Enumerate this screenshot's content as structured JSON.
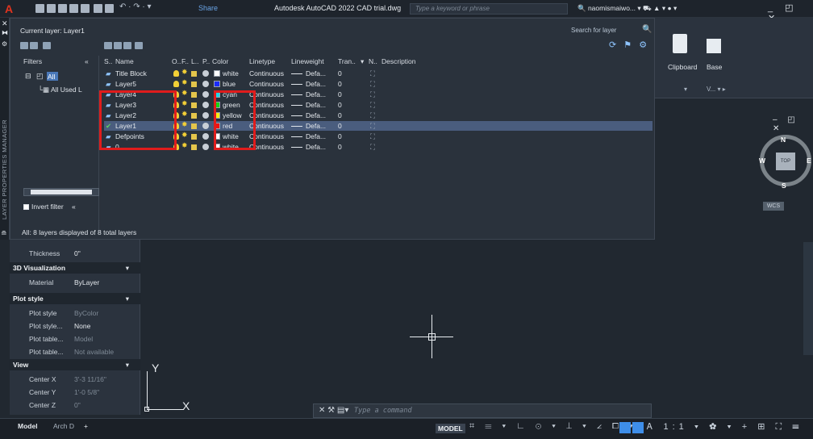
{
  "titlebar": {
    "share": "Share",
    "title": "Autodesk AutoCAD 2022   CAD trial.dwg",
    "search_placeholder": "Type a keyword or phrase",
    "user": "naomismaiwo...",
    "window_controls": "_ ◰ ✕"
  },
  "lpm": {
    "side_label": "LAYER PROPERTIES MANAGER",
    "current_layer": "Current layer: Layer1",
    "search_label": "Search for layer",
    "filters_header": "Filters",
    "filters_collapse": "«",
    "filter_all": "All",
    "filter_all_used": "All Used L",
    "invert_filter": "Invert filter",
    "invert_collapse": "«",
    "status_line": "All: 8 layers displayed of 8 total layers",
    "columns": {
      "s": "S..",
      "name": "Name",
      "o": "O..",
      "f": "F..",
      "l": "L..",
      "p": "P..",
      "color": "Color",
      "linetype": "Linetype",
      "lineweight": "Lineweight",
      "trans": "Tran..",
      "n": "N..",
      "desc": "Description"
    },
    "rows": [
      {
        "name": "Title Block",
        "color": "white",
        "swatch": "#ffffff",
        "linetype": "Continuous",
        "lineweight": "Defa...",
        "trans": "0",
        "selected": false,
        "current": false
      },
      {
        "name": "Layer5",
        "color": "blue",
        "swatch": "#1a2bff",
        "linetype": "Continuous",
        "lineweight": "Defa...",
        "trans": "0",
        "selected": false,
        "current": false
      },
      {
        "name": "Layer4",
        "color": "cyan",
        "swatch": "#19d8e8",
        "linetype": "Continuous",
        "lineweight": "Defa...",
        "trans": "0",
        "selected": false,
        "current": false
      },
      {
        "name": "Layer3",
        "color": "green",
        "swatch": "#14d814",
        "linetype": "Continuous",
        "lineweight": "Defa...",
        "trans": "0",
        "selected": false,
        "current": false
      },
      {
        "name": "Layer2",
        "color": "yellow",
        "swatch": "#f5ef12",
        "linetype": "Continuous",
        "lineweight": "Defa...",
        "trans": "0",
        "selected": false,
        "current": false
      },
      {
        "name": "Layer1",
        "color": "red",
        "swatch": "#ee1111",
        "linetype": "Continuous",
        "lineweight": "Defa...",
        "trans": "0",
        "selected": true,
        "current": true
      },
      {
        "name": "Defpoints",
        "color": "white",
        "swatch": "#ffffff",
        "linetype": "Continuous",
        "lineweight": "Defa...",
        "trans": "0",
        "selected": false,
        "current": false
      },
      {
        "name": "0",
        "color": "white",
        "swatch": "#ffffff",
        "linetype": "Continuous",
        "lineweight": "Defa...",
        "trans": "0",
        "selected": false,
        "current": false
      }
    ]
  },
  "ribbon": {
    "clipboard": "Clipboard",
    "base": "Base",
    "dd1": "▾",
    "dd2": "V... ▾ ▸"
  },
  "viewcube": {
    "top": "TOP",
    "n": "N",
    "s": "S",
    "w": "W",
    "e": "E",
    "wcs": "WCS"
  },
  "drawing_controls": "– ◰ ✕",
  "properties": {
    "thickness_key": "Thickness",
    "thickness_val": "0\"",
    "sec_3d": "3D Visualization",
    "material_key": "Material",
    "material_val": "ByLayer",
    "sec_plot": "Plot style",
    "rows_plot": [
      {
        "k": "Plot style",
        "v": "ByColor",
        "dim": true
      },
      {
        "k": "Plot style...",
        "v": "None",
        "dim": false
      },
      {
        "k": "Plot table...",
        "v": "Model",
        "dim": true
      },
      {
        "k": "Plot table...",
        "v": "Not available",
        "dim": true
      }
    ],
    "sec_view": "View",
    "rows_view": [
      {
        "k": "Center X",
        "v": "3'-3 11/16\"",
        "dim": true
      },
      {
        "k": "Center Y",
        "v": "1'-0 5/8\"",
        "dim": true
      },
      {
        "k": "Center Z",
        "v": "0\"",
        "dim": true
      }
    ],
    "arrow": "▾"
  },
  "ucs": {
    "y": "Y",
    "x": "X"
  },
  "command": {
    "prefix": "✕ ⚒ ▤▾",
    "placeholder": "Type a command"
  },
  "statusbar": {
    "tab_model": "Model",
    "tab_arch": "Arch D",
    "tab_add": "+",
    "model_btn": "MODEL",
    "tray": "⌗ ☰ ▾ ∟ ⊙ ▾ ⟂ ▾ ∠ ⧠ ▾",
    "tray2": "Ꭺ 1:1 ▾ ✿ ▾ + ⊞ ⛶ ☰"
  }
}
